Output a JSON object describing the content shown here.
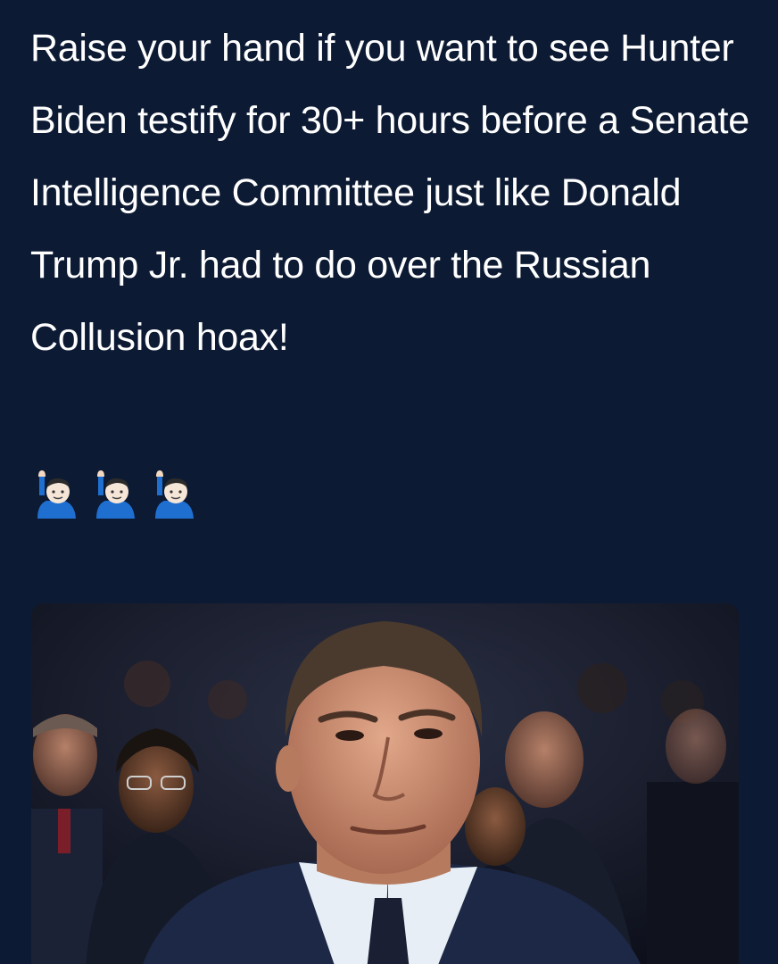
{
  "tweet": {
    "text": "Raise your hand if you want to see Hunter Biden testify for 30+ hours before a Senate Intelligence Committee just like Donald Trump Jr. had to do over the Russian Collusion hoax!",
    "emojis": [
      "person-raising-hand-icon",
      "person-raising-hand-icon",
      "person-raising-hand-icon"
    ]
  },
  "colors": {
    "background": "#0c1a33",
    "text": "#ffffff",
    "emoji_sleeve": "#1f6fd1"
  },
  "media": {
    "kind": "photo"
  }
}
